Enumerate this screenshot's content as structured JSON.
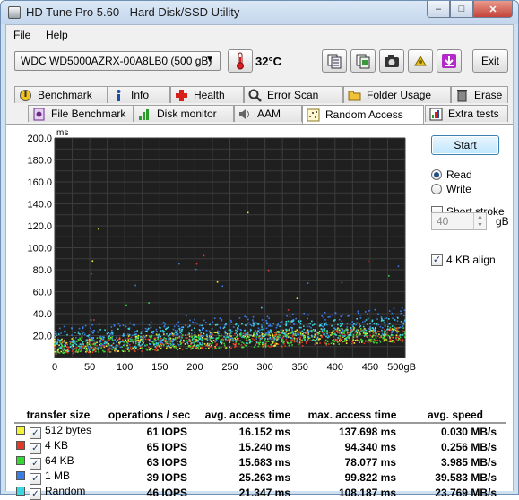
{
  "window": {
    "title": "HD Tune Pro 5.60 - Hard Disk/SSD Utility",
    "buttons": {
      "minimize": "–",
      "maximize": "□",
      "close": "✕"
    }
  },
  "menu": {
    "file": "File",
    "help": "Help"
  },
  "toolbar": {
    "drive": "WDC WD5000AZRX-00A8LB0 (500 gB)",
    "temperature": "32°C",
    "exit": "Exit",
    "icons": [
      "copy-text-icon",
      "copy-info-icon",
      "camera-icon",
      "settings-icon",
      "download-icon"
    ]
  },
  "tabs": {
    "row1": [
      {
        "label": "Benchmark",
        "icon": "benchmark-icon"
      },
      {
        "label": "Info",
        "icon": "info-icon"
      },
      {
        "label": "Health",
        "icon": "health-icon"
      },
      {
        "label": "Error Scan",
        "icon": "error-scan-icon"
      },
      {
        "label": "Folder Usage",
        "icon": "folder-icon"
      },
      {
        "label": "Erase",
        "icon": "erase-icon"
      }
    ],
    "row2": [
      {
        "label": "File Benchmark",
        "icon": "file-benchmark-icon"
      },
      {
        "label": "Disk monitor",
        "icon": "disk-monitor-icon"
      },
      {
        "label": "AAM",
        "icon": "speaker-icon"
      },
      {
        "label": "Random Access",
        "icon": "random-access-icon",
        "active": true
      },
      {
        "label": "Extra tests",
        "icon": "extra-tests-icon"
      }
    ]
  },
  "controls": {
    "start": "Start",
    "read": "Read",
    "write": "Write",
    "mode": "read",
    "short_stroke": "Short stroke",
    "short_stroke_checked": false,
    "short_stroke_value": "40",
    "short_stroke_unit": "gB",
    "align": "4 KB align",
    "align_checked": true
  },
  "chart_data": {
    "type": "scatter",
    "ylabel": "ms",
    "xlabel": "",
    "x_unit": "gB",
    "xlim": [
      0,
      500
    ],
    "ylim": [
      0,
      200
    ],
    "x_ticks": [
      "0",
      "50",
      "100",
      "150",
      "200",
      "250",
      "300",
      "350",
      "400",
      "450",
      "500gB"
    ],
    "y_ticks": [
      "20.0",
      "40.0",
      "60.0",
      "80.0",
      "100.0",
      "120.0",
      "140.0",
      "160.0",
      "180.0",
      "200.0"
    ],
    "background": "#1f1f1f",
    "grid": true,
    "series": [
      {
        "name": "512 bytes",
        "color": "#f2f23a",
        "avg_ms": 16.152,
        "max_ms": 137.698
      },
      {
        "name": "4 KB",
        "color": "#e03a2a",
        "avg_ms": 15.24,
        "max_ms": 94.34
      },
      {
        "name": "64 KB",
        "color": "#36d636",
        "avg_ms": 15.683,
        "max_ms": 78.077
      },
      {
        "name": "1 MB",
        "color": "#3a7de8",
        "avg_ms": 25.263,
        "max_ms": 99.822
      },
      {
        "name": "Random",
        "color": "#3ad8e0",
        "avg_ms": 21.347,
        "max_ms": 108.187
      }
    ]
  },
  "results": {
    "headers": [
      "transfer size",
      "operations / sec",
      "avg. access time",
      "max. access time",
      "avg. speed"
    ],
    "rows": [
      {
        "size": "512 bytes",
        "color": "#f2f23a",
        "ops": "61 IOPS",
        "avg": "16.152 ms",
        "max": "137.698 ms",
        "speed": "0.030 MB/s"
      },
      {
        "size": "4 KB",
        "color": "#e03a2a",
        "ops": "65 IOPS",
        "avg": "15.240 ms",
        "max": "94.340 ms",
        "speed": "0.256 MB/s"
      },
      {
        "size": "64 KB",
        "color": "#36d636",
        "ops": "63 IOPS",
        "avg": "15.683 ms",
        "max": "78.077 ms",
        "speed": "3.985 MB/s"
      },
      {
        "size": "1 MB",
        "color": "#3a7de8",
        "ops": "39 IOPS",
        "avg": "25.263 ms",
        "max": "99.822 ms",
        "speed": "39.583 MB/s"
      },
      {
        "size": "Random",
        "color": "#3ad8e0",
        "ops": "46 IOPS",
        "avg": "21.347 ms",
        "max": "108.187 ms",
        "speed": "23.769 MB/s"
      }
    ]
  }
}
